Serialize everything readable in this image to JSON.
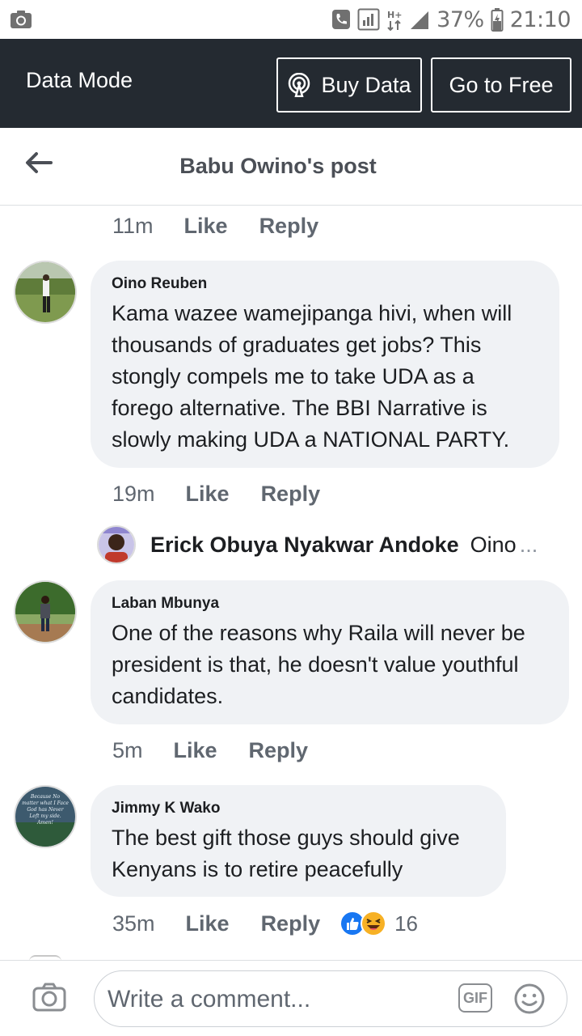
{
  "status_bar": {
    "battery_percent": "37%",
    "time": "21:10",
    "network_label": "H+"
  },
  "banner": {
    "mode_label": "Data Mode",
    "buy_data_label": "Buy Data",
    "go_free_label": "Go to Free"
  },
  "header": {
    "title": "Babu Owino's post"
  },
  "top_meta": {
    "time": "11m",
    "like": "Like",
    "reply": "Reply"
  },
  "comments": [
    {
      "author": "Oino Reuben",
      "text": "Kama wazee wamejipanga hivi, when will thousands of graduates get jobs? This stongly compels me to take UDA as a forego alternative. The BBI Narrative is slowly making UDA a NATIONAL PARTY.",
      "lines": [
        "Kama wazee wamejipanga hivi, when will",
        "thousands of graduates get jobs? This",
        "stongly compels me to take UDA as a",
        "forego alternative. The BBI Narrative is",
        "slowly making UDA a NATIONAL PARTY."
      ],
      "time": "19m",
      "like": "Like",
      "reply": "Reply"
    },
    {
      "author": "Laban Mbunya",
      "lines": [
        "One of the reasons why Raila will never be",
        "president is that, he doesn't value youthful",
        "candidates."
      ],
      "time": "5m",
      "like": "Like",
      "reply": "Reply"
    },
    {
      "author": "Jimmy K Wako",
      "lines": [
        "The best gift those guys should give",
        "Kenyans is to retire peacefully"
      ],
      "time": "35m",
      "like": "Like",
      "reply": "Reply",
      "reaction_count": "16",
      "reactions": [
        "like-reaction-icon",
        "haha-reaction-icon"
      ]
    }
  ],
  "reply_preview": {
    "author": "Erick Obuya Nyakwar Andoke",
    "text": "Oino",
    "ellipsis": "..."
  },
  "composer": {
    "placeholder": "Write a comment...",
    "gif_label": "GIF"
  },
  "colors": {
    "banner_bg": "#242a31",
    "bubble_bg": "#f0f2f5",
    "like_blue": "#1877f2",
    "haha_yellow": "#f7b125"
  }
}
